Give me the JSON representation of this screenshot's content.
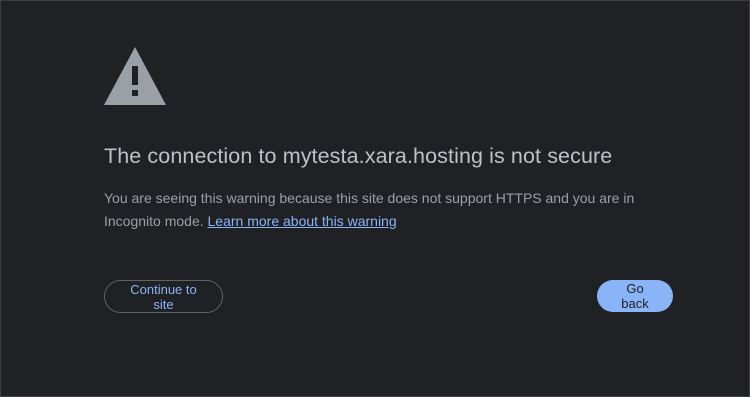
{
  "page": {
    "title": "The connection to mytesta.xara.hosting is not secure",
    "description": "You are seeing this warning because this site does not support HTTPS and you are in Incognito mode.",
    "learn_more_link": "Learn more about this warning"
  },
  "buttons": {
    "continue_label": "Continue to site",
    "back_label": "Go back"
  },
  "icons": {
    "warning": "warning-triangle-icon"
  },
  "colors": {
    "background": "#202124",
    "title": "#bdc1c6",
    "body_text": "#9aa0a6",
    "link": "#8ab4f8",
    "primary_button": "#8ab4f8",
    "icon": "#9aa0a6"
  }
}
